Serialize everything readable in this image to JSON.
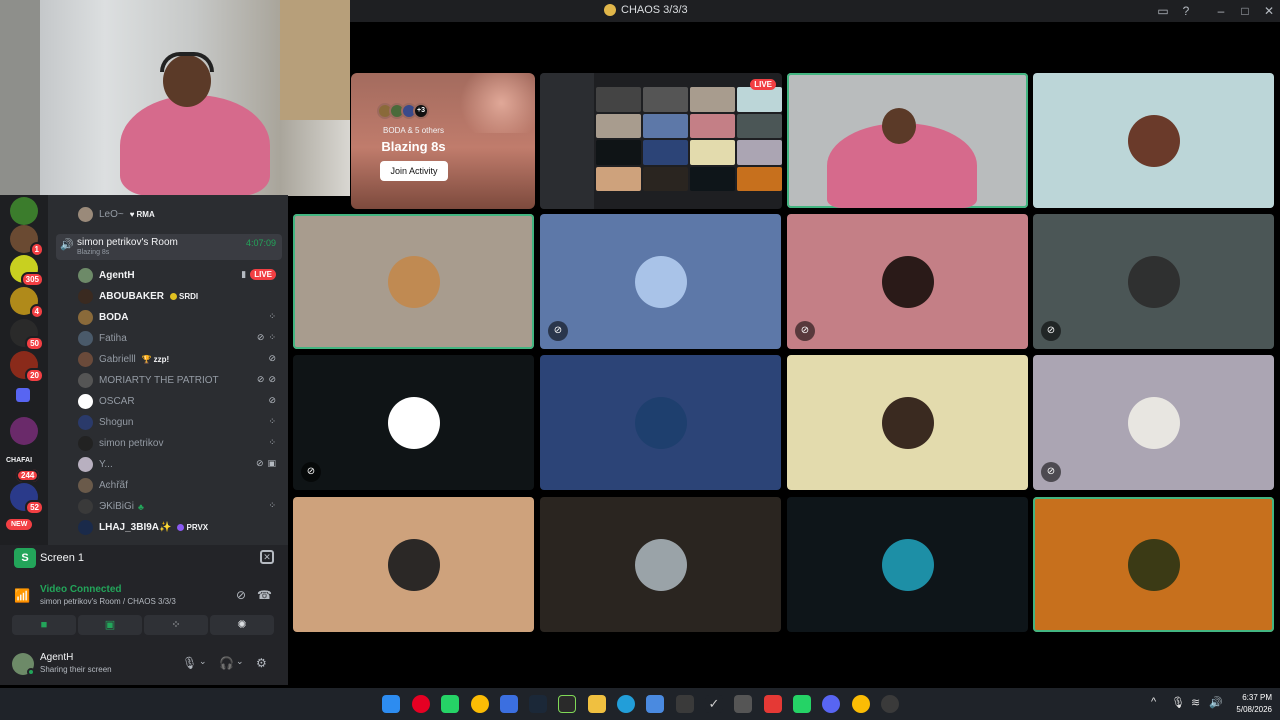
{
  "window": {
    "title": "CHAOS 3/3/3"
  },
  "sidebar": {
    "guild_badges": [
      "1",
      "305",
      "4",
      "50",
      "20",
      "244",
      "52"
    ],
    "guild_label": "CHAFAI",
    "new_badge": "NEW",
    "members_top": [
      {
        "name": "LeO~",
        "tag": "RMA"
      }
    ],
    "room": {
      "name": "simon petrikov's Room",
      "activity": "Blazing 8s",
      "duration": "4:07:09"
    },
    "members": [
      {
        "name": "AgentH",
        "status": "LIVE",
        "bright": true
      },
      {
        "name": "ABOUBAKER",
        "tag": "SRDI",
        "bright": true
      },
      {
        "name": "BODA",
        "bright": true
      },
      {
        "name": "Fatiha"
      },
      {
        "name": "Gabrielll",
        "tag": "zzp!"
      },
      {
        "name": "MORIARTY THE PATRIOT"
      },
      {
        "name": "OSCAR"
      },
      {
        "name": "Shogun"
      },
      {
        "name": "simon petrikov"
      },
      {
        "name": "Y..."
      },
      {
        "name": "Aͼhřãf"
      },
      {
        "name": "ЭKiBiGi"
      },
      {
        "name": "LHAJ_3BI9A✨",
        "tag": "PRVX"
      }
    ]
  },
  "voice_panel": {
    "screen_label": "Screen 1",
    "status": "Video Connected",
    "location": "simon petrikov's Room / CHAOS 3/3/3"
  },
  "user_panel": {
    "username": "AgentH",
    "status_text": "Sharing their screen"
  },
  "activity": {
    "participants": "BODA & 5 others",
    "more_count": "+3",
    "game": "Blazing 8s",
    "join_label": "Join Activity"
  },
  "screen_share": {
    "live_label": "LIVE"
  },
  "tiles": [
    {
      "bg": "#a89c8e",
      "avatar": "#c08a52",
      "speaking": true,
      "muted": false
    },
    {
      "bg": "#5d78a8",
      "avatar": "#a9c3e8",
      "speaking": false,
      "muted": true
    },
    {
      "bg": "#c47f86",
      "avatar": "#2a1a18",
      "speaking": false,
      "muted": true
    },
    {
      "bg": "#4b5656",
      "avatar": "#2f3030",
      "speaking": false,
      "muted": true
    },
    {
      "bg": "#0f1416",
      "avatar": "#ffffff",
      "speaking": false,
      "muted": true
    },
    {
      "bg": "#2c4477",
      "avatar": "#1e3f6e",
      "speaking": false,
      "muted": false
    },
    {
      "bg": "#e3dbad",
      "avatar": "#3a2a20",
      "speaking": false,
      "muted": false
    },
    {
      "bg": "#aba5b3",
      "avatar": "#e8e6e1",
      "speaking": false,
      "muted": true
    },
    {
      "bg": "#cea27c",
      "avatar": "#2b2826",
      "speaking": false,
      "muted": false
    },
    {
      "bg": "#2a2520",
      "avatar": "#9aa3a8",
      "speaking": false,
      "muted": false
    },
    {
      "bg": "#0e1519",
      "avatar": "#1d8fa6",
      "speaking": false,
      "muted": false
    },
    {
      "bg": "#c7701d",
      "avatar": "#3b3a15",
      "speaking": true,
      "muted": false
    }
  ],
  "taskbar": {
    "time": "6:37 PM",
    "date": "5/08/2026"
  },
  "icons": {
    "speaker": "speaker-icon",
    "camera": "camera-icon",
    "mute": "mic-muted-icon",
    "signal": "signal-icon",
    "settings": "gear-icon"
  }
}
